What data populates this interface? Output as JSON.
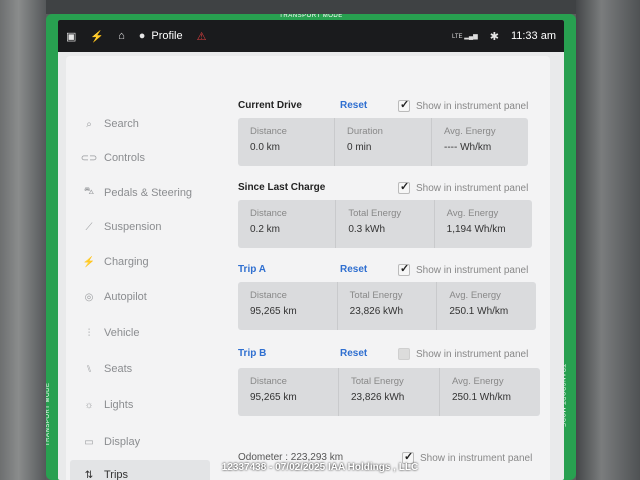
{
  "status_bar": {
    "profile_label": "Profile",
    "network": "LTE",
    "time": "11:33 am",
    "transport_mode": "TRANSPORT MODE"
  },
  "sidebar": {
    "items": [
      {
        "label": "Search",
        "icon": "search-icon"
      },
      {
        "label": "Controls",
        "icon": "toggle-icon"
      },
      {
        "label": "Pedals & Steering",
        "icon": "car-icon"
      },
      {
        "label": "Suspension",
        "icon": "suspension-icon"
      },
      {
        "label": "Charging",
        "icon": "lightning-icon"
      },
      {
        "label": "Autopilot",
        "icon": "steering-wheel-icon"
      },
      {
        "label": "Vehicle",
        "icon": "sliders-icon"
      },
      {
        "label": "Seats",
        "icon": "seat-icon"
      },
      {
        "label": "Lights",
        "icon": "sun-icon"
      },
      {
        "label": "Display",
        "icon": "display-icon"
      },
      {
        "label": "Trips",
        "icon": "trips-icon"
      }
    ],
    "active": "Trips"
  },
  "trips": {
    "current_drive": {
      "title": "Current Drive",
      "reset": "Reset",
      "show_label": "Show in instrument panel",
      "checked": true,
      "cells": [
        {
          "label": "Distance",
          "value": "0.0 km"
        },
        {
          "label": "Duration",
          "value": "0 min"
        },
        {
          "label": "Avg. Energy",
          "value": "---- Wh/km"
        }
      ]
    },
    "since_last_charge": {
      "title": "Since Last Charge",
      "show_label": "Show in instrument panel",
      "checked": true,
      "cells": [
        {
          "label": "Distance",
          "value": "0.2 km"
        },
        {
          "label": "Total Energy",
          "value": "0.3 kWh"
        },
        {
          "label": "Avg. Energy",
          "value": "1,194 Wh/km"
        }
      ]
    },
    "trip_a": {
      "title": "Trip A",
      "reset": "Reset",
      "show_label": "Show in instrument panel",
      "checked": true,
      "cells": [
        {
          "label": "Distance",
          "value": "95,265 km"
        },
        {
          "label": "Total Energy",
          "value": "23,826 kWh"
        },
        {
          "label": "Avg. Energy",
          "value": "250.1 Wh/km"
        }
      ]
    },
    "trip_b": {
      "title": "Trip B",
      "reset": "Reset",
      "show_label": "Show in instrument panel",
      "checked": false,
      "cells": [
        {
          "label": "Distance",
          "value": "95,265 km"
        },
        {
          "label": "Total Energy",
          "value": "23,826 kWh"
        },
        {
          "label": "Avg. Energy",
          "value": "250.1 Wh/km"
        }
      ]
    },
    "odometer": {
      "text": "Odometer : 223,293 km",
      "show_label": "Show in instrument panel",
      "checked": true
    }
  },
  "watermark": "12337438 - 07/02/2025 IAA Holdings , LLC",
  "colors": {
    "accent_blue": "#2f6fd0",
    "transport_green": "#28a050",
    "status_bar": "#1a1b1d"
  }
}
